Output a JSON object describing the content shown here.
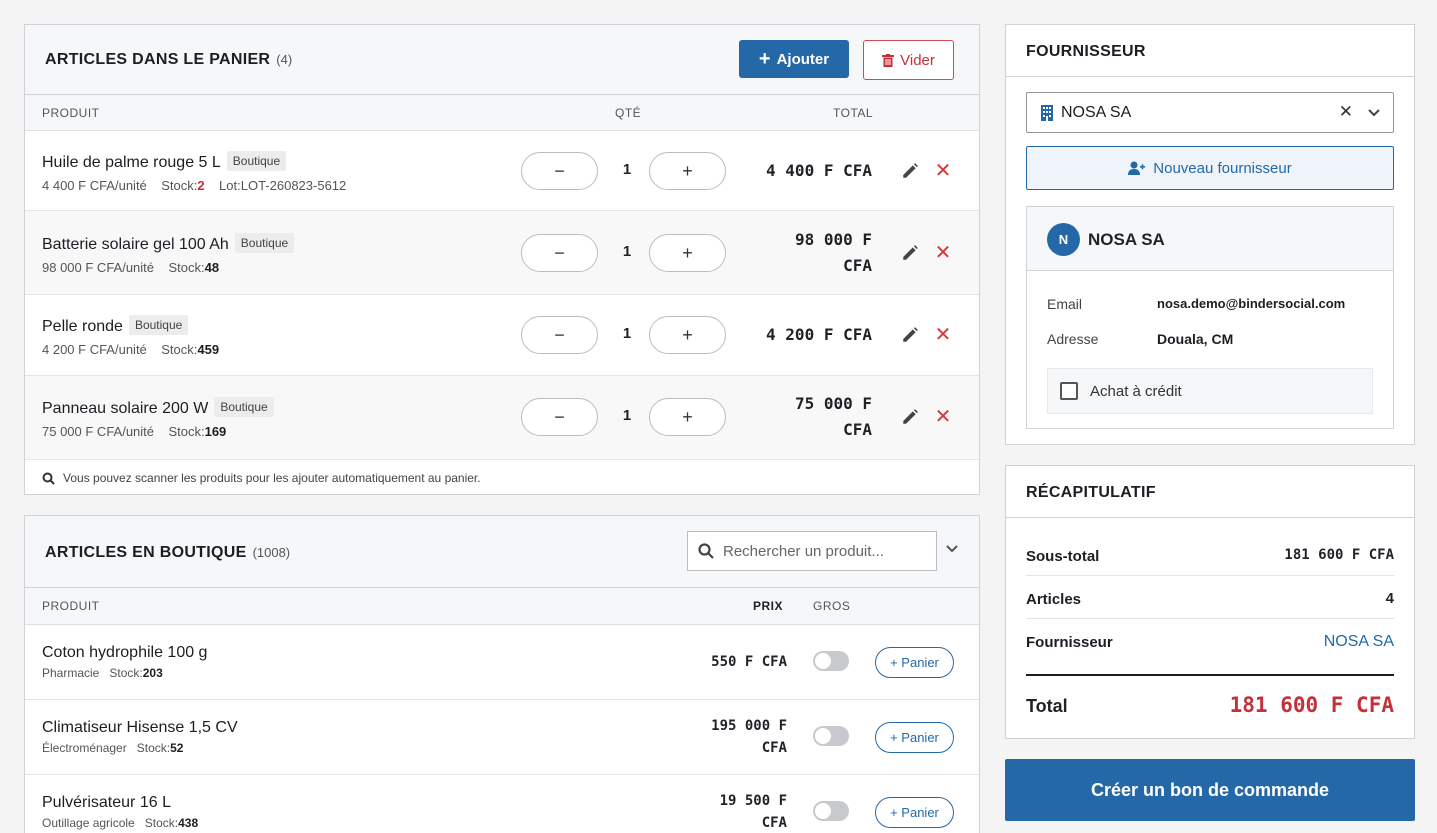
{
  "cart": {
    "title": "ARTICLES DANS LE PANIER",
    "count": "(4)",
    "add_label": "Ajouter",
    "clear_label": "Vider",
    "columns": {
      "product": "PRODUIT",
      "qty": "QTÉ",
      "total": "TOTAL"
    },
    "items": [
      {
        "name": "Huile de palme rouge 5 L",
        "tag": "Boutique",
        "unit_price": "4 400 F CFA/unité",
        "stock_label": "Stock:",
        "stock": "2",
        "lot": "Lot:LOT-260823-5612",
        "qty": "1",
        "total_1": "4 400 F CFA",
        "total_2": ""
      },
      {
        "name": "Batterie solaire gel 100 Ah",
        "tag": "Boutique",
        "unit_price": "98 000 F CFA/unité",
        "stock_label": "Stock:",
        "stock": "48",
        "lot": "",
        "qty": "1",
        "total_1": "98 000 F",
        "total_2": "CFA"
      },
      {
        "name": "Pelle ronde",
        "tag": "Boutique",
        "unit_price": "4 200 F CFA/unité",
        "stock_label": "Stock:",
        "stock": "459",
        "lot": "",
        "qty": "1",
        "total_1": "4 200 F CFA",
        "total_2": ""
      },
      {
        "name": "Panneau solaire 200 W",
        "tag": "Boutique",
        "unit_price": "75 000 F CFA/unité",
        "stock_label": "Stock:",
        "stock": "169",
        "lot": "",
        "qty": "1",
        "total_1": "75 000 F",
        "total_2": "CFA"
      }
    ],
    "hint": "Vous pouvez scanner les produits pour les ajouter automatiquement au panier."
  },
  "shop": {
    "title": "ARTICLES EN BOUTIQUE",
    "count": "(1008)",
    "search_placeholder": "Rechercher un produit...",
    "columns": {
      "product": "PRODUIT",
      "price": "PRIX",
      "bulk": "GROS"
    },
    "add_to_cart_label": "+ Panier",
    "items": [
      {
        "name": "Coton hydrophile 100 g",
        "category": "Pharmacie",
        "stock_label": "Stock:",
        "stock": "203",
        "price_1": "550 F CFA",
        "price_2": "",
        "bulk": false
      },
      {
        "name": "Climatiseur Hisense 1,5 CV",
        "category": "Électroménager",
        "stock_label": "Stock:",
        "stock": "52",
        "price_1": "195 000 F",
        "price_2": "CFA",
        "bulk": false
      },
      {
        "name": "Pulvérisateur 16 L",
        "category": "Outillage agricole",
        "stock_label": "Stock:",
        "stock": "438",
        "price_1": "19 500 F",
        "price_2": "CFA",
        "bulk": false
      }
    ]
  },
  "supplier": {
    "title": "FOURNISSEUR",
    "selected": "NOSA SA",
    "new_label": "Nouveau fournisseur",
    "card": {
      "initial": "N",
      "name": "NOSA SA",
      "email_label": "Email",
      "email": "nosa.demo@bindersocial.com",
      "address_label": "Adresse",
      "address": "Douala, CM",
      "credit_label": "Achat à crédit",
      "credit_checked": false
    }
  },
  "summary": {
    "title": "RÉCAPITULATIF",
    "subtotal_label": "Sous-total",
    "subtotal": "181 600 F CFA",
    "articles_label": "Articles",
    "articles": "4",
    "supplier_label": "Fournisseur",
    "supplier": "NOSA SA",
    "total_label": "Total",
    "total": "181 600 F CFA"
  },
  "create_label": "Créer un bon de commande",
  "colors": {
    "primary": "#2568a8",
    "danger": "#c4313a"
  }
}
